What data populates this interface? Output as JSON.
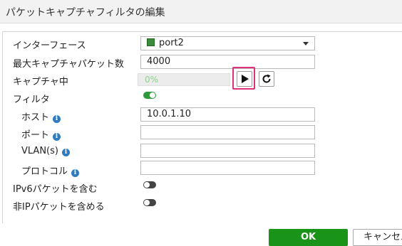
{
  "dialog": {
    "title": "パケットキャプチャフィルタの編集"
  },
  "form": {
    "interface": {
      "label": "インターフェース",
      "value": "port2",
      "icon": "port-icon"
    },
    "max_packets": {
      "label": "最大キャプチャパケット数",
      "value": "4000"
    },
    "capturing": {
      "label": "キャプチャ中",
      "progress_text": "0%",
      "progress_fraction": 0
    },
    "filter": {
      "label": "フィルタ",
      "enabled": true
    },
    "host": {
      "label": "ホスト",
      "value": "10.0.1.10"
    },
    "port": {
      "label": "ポート",
      "value": ""
    },
    "vlan": {
      "label": "VLAN(s)",
      "value": ""
    },
    "protocol": {
      "label": "プロトコル",
      "value": ""
    },
    "ipv6": {
      "label": "IPv6パケットを含む",
      "enabled": false
    },
    "non_ip": {
      "label": "非IPパケットを含める",
      "enabled": false
    }
  },
  "buttons": {
    "ok": "OK",
    "cancel": "キャンセル"
  },
  "colors": {
    "accent_green": "#199419",
    "highlight": "#e0307a",
    "info_blue": "#2f7bbf"
  }
}
